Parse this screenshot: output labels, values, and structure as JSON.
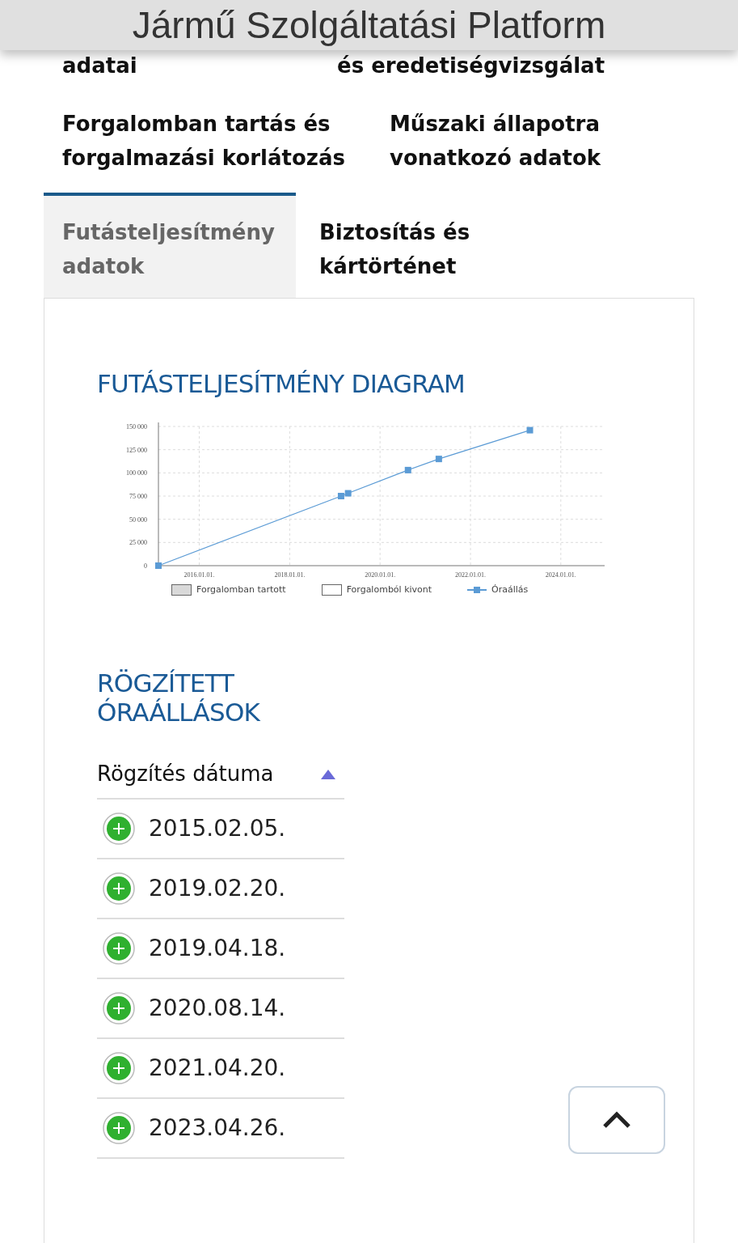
{
  "header": {
    "title": "Jármű Szolgáltatási Platform"
  },
  "tab_rows": [
    [
      {
        "label": "adatai",
        "selected": false
      },
      {
        "label": "és eredetiségvizsgálat",
        "selected": false
      }
    ],
    [
      {
        "label": "Forgalomban tartás és forgalmazási korlátozás",
        "selected": false
      },
      {
        "label": "Műszaki állapotra vonatkozó adatok",
        "selected": false
      }
    ],
    [
      {
        "label": "Futásteljesítmény adatok",
        "selected": true
      },
      {
        "label": "Biztosítás és kártörténet",
        "selected": false
      }
    ]
  ],
  "diagram": {
    "title": "FUTÁSTELJESÍTMÉNY DIAGRAM",
    "chart_data": {
      "type": "line",
      "grid": true,
      "xlim": [
        "2015-02-05",
        "2024-12-20"
      ],
      "ylim": [
        0,
        150000
      ],
      "xticks": [
        {
          "value": "2016-01-01",
          "label": "2016.01.01."
        },
        {
          "value": "2018-01-01",
          "label": "2018.01.01."
        },
        {
          "value": "2020-01-01",
          "label": "2020.01.01."
        },
        {
          "value": "2022-01-01",
          "label": "2022.01.01."
        },
        {
          "value": "2024-01-01",
          "label": "2024.01.01."
        }
      ],
      "yticks": [
        {
          "value": 0,
          "label": "0"
        },
        {
          "value": 25000,
          "label": "25 000"
        },
        {
          "value": 50000,
          "label": "50 000"
        },
        {
          "value": 75000,
          "label": "75 000"
        },
        {
          "value": 100000,
          "label": "100 000"
        },
        {
          "value": 125000,
          "label": "125 000"
        },
        {
          "value": 150000,
          "label": "150 000"
        }
      ],
      "x": [
        "2015-02-05",
        "2019-02-20",
        "2019-04-18",
        "2020-08-14",
        "2021-04-20",
        "2023-04-26"
      ],
      "series": [
        {
          "name": "Óraállás",
          "color": "#5b9bd5",
          "marker": "square",
          "values": [
            0,
            75000,
            78000,
            103000,
            115000,
            146000
          ]
        }
      ]
    },
    "legend": [
      {
        "kind": "box",
        "label": "Forgalomban tartott",
        "color": "#d9d9d9"
      },
      {
        "kind": "box",
        "label": "Forgalomból kivont",
        "color": "#ffffff"
      }
    ]
  },
  "readings": {
    "title": "RÖGZÍTETT ÓRAÁLLÁSOK",
    "column": "Rögzítés dátuma",
    "sorted_ascending": true,
    "rows": [
      {
        "date": "2015.02.05.",
        "expanded": false
      },
      {
        "date": "2019.02.20.",
        "expanded": false
      },
      {
        "date": "2019.04.18.",
        "expanded": false
      },
      {
        "date": "2020.08.14.",
        "expanded": false
      },
      {
        "date": "2021.04.20.",
        "expanded": false
      },
      {
        "date": "2023.04.26.",
        "expanded": false
      }
    ]
  }
}
